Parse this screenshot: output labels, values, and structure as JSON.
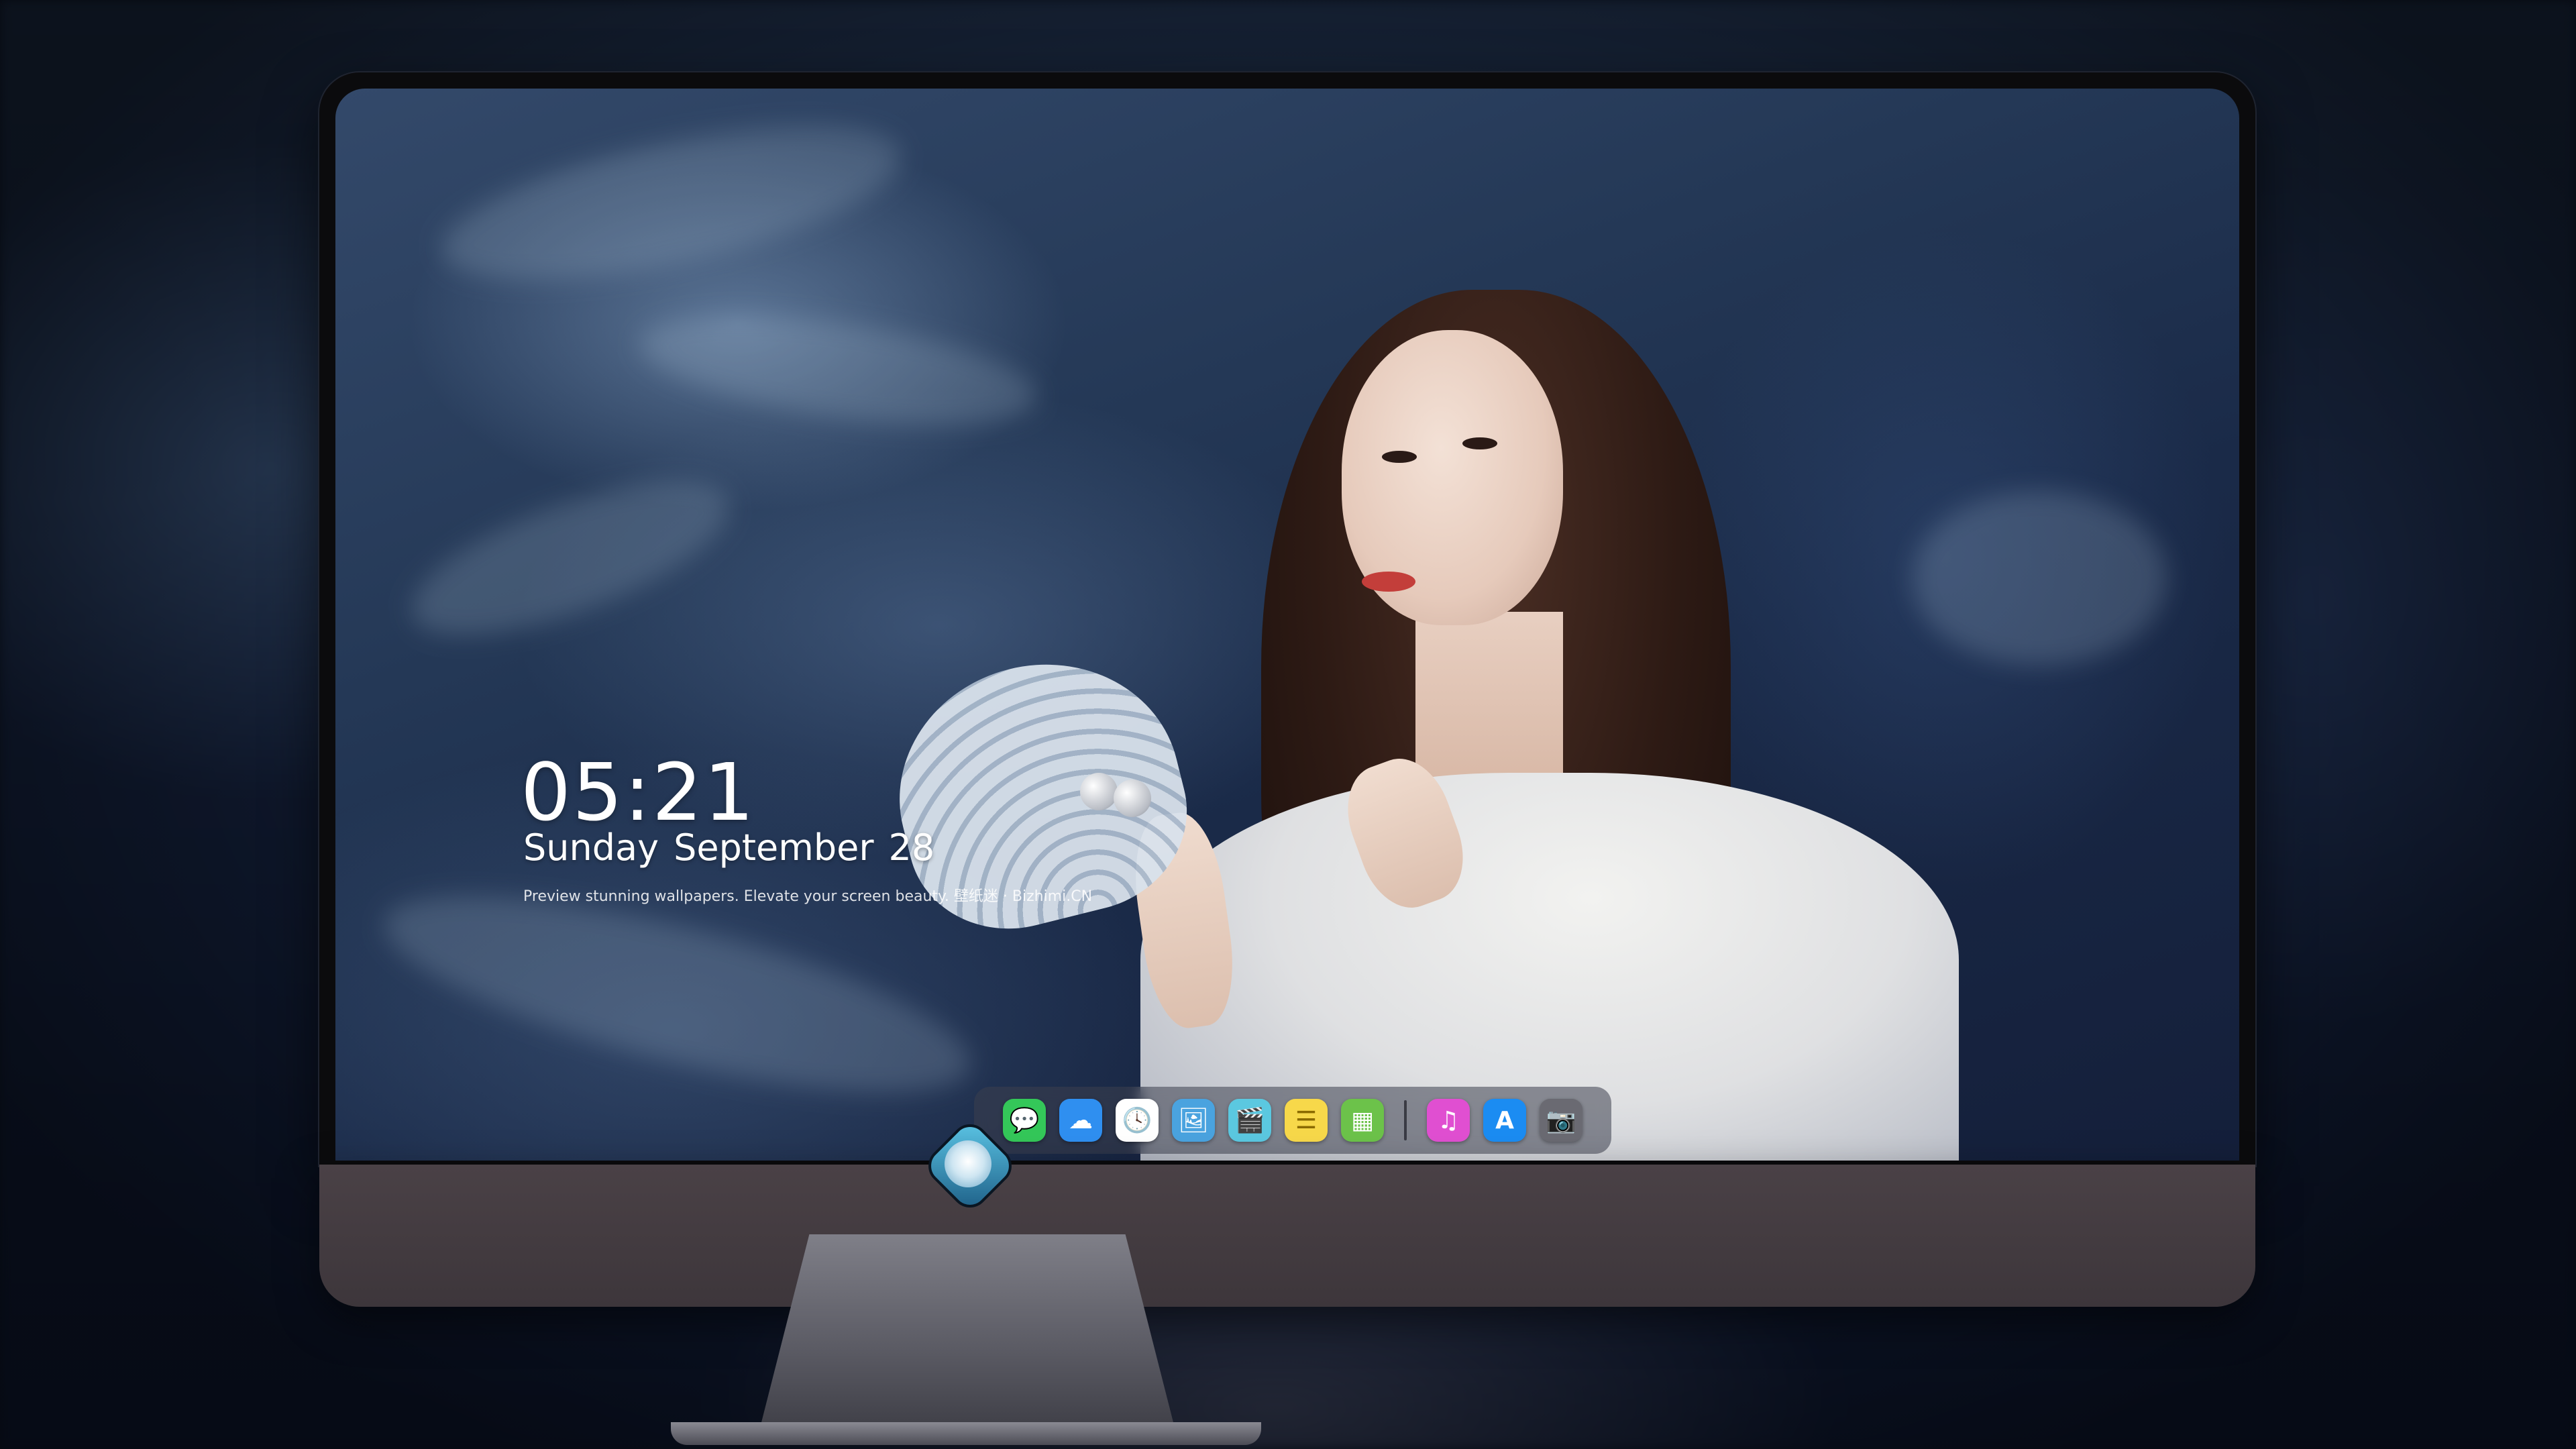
{
  "lockscreen": {
    "time": "05:21",
    "weekday": "Sunday",
    "month": "September",
    "day": "28",
    "caption": "Preview stunning wallpapers. Elevate your screen beauty. 壁纸迷 · Bizhimi.CN"
  },
  "dock": {
    "apps": [
      {
        "name": "messages-icon",
        "glyph": "💬",
        "color": "#34c759"
      },
      {
        "name": "weather-icon",
        "glyph": "☁",
        "color": "#2f8ff0"
      },
      {
        "name": "clock-icon",
        "glyph": "🕓",
        "color": "#ffffff"
      },
      {
        "name": "preview-icon",
        "glyph": "🖼",
        "color": "#4aa3df"
      },
      {
        "name": "clapper-icon",
        "glyph": "🎬",
        "color": "#5bc8e0"
      },
      {
        "name": "notes-icon",
        "glyph": "☰",
        "color": "#f7d84a"
      },
      {
        "name": "photo-booth-icon",
        "glyph": "▦",
        "color": "#6cc24a"
      },
      {
        "name": "music-icon",
        "glyph": "♫",
        "color": "#e04fd1"
      },
      {
        "name": "app-store-icon",
        "glyph": "A",
        "color": "#1b8cf2"
      },
      {
        "name": "camera-icon",
        "glyph": "📷",
        "color": "#6a6a72"
      }
    ]
  },
  "brand": {
    "logo": "dragon-mascot-logo"
  }
}
